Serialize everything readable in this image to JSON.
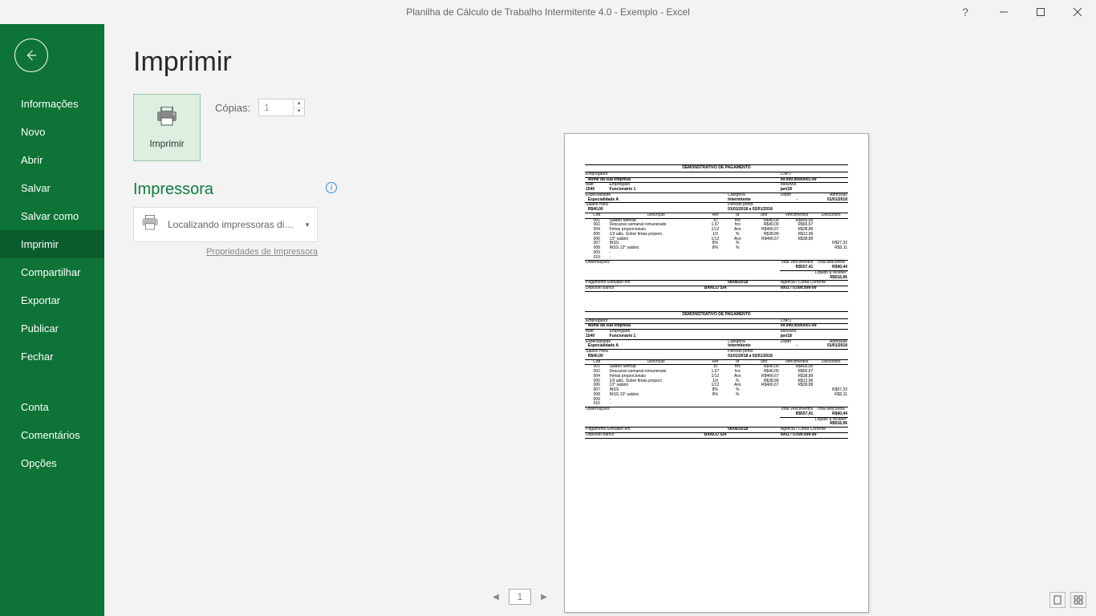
{
  "window": {
    "title": "Planilha de Cálculo de Trabalho Intermitente 4.0 - Exemplo  -  Excel"
  },
  "sidebar": {
    "items": [
      "Informações",
      "Novo",
      "Abrir",
      "Salvar",
      "Salvar como",
      "Imprimir",
      "Compartilhar",
      "Exportar",
      "Publicar",
      "Fechar",
      "Conta",
      "Comentários",
      "Opções"
    ],
    "active_index": 5
  },
  "print": {
    "heading": "Imprimir",
    "button_label": "Imprimir",
    "copies_label": "Cópias:",
    "copies_value": "1",
    "printer_heading": "Impressora",
    "printer_status": "Localizando impressoras dis...",
    "printer_props": "Propriedades de Impressora"
  },
  "pager": {
    "page": "1"
  },
  "slip": {
    "title": "DEMONSTRATIVO DE PAGAMENTO",
    "labels": {
      "empregador": "Empregador",
      "cnpj": "CNPJ",
      "matr": "Matr",
      "empregado": "Empregado",
      "mesano": "Mês/Ano",
      "especialidade": "Especialidade",
      "categoria": "Categoria",
      "depto": "Depto",
      "admissao": "Admissão",
      "salario_hora": "Salário Hora",
      "periodo_ponto": "Período ponto",
      "cod": "Cód",
      "descricao": "Descrição",
      "ref": "Ref",
      "id": "Id",
      "unit": "unit",
      "vencimentos": "Vencimentos",
      "descontos": "Descontos",
      "observacoes": "Observações:",
      "total_venc": "Total Vencimentos",
      "total_desc": "Total descontos",
      "liquido": "Líquido a receber:",
      "pag_efetuado": "Pagamento Efetuado em:",
      "agencia": "Agência / Conta Corrente",
      "deposito": "Depósito Banco"
    },
    "values": {
      "empresa": "Nome da sua empresa",
      "cnpj": "99.999.999/0001-99",
      "matr": "1540",
      "empregado": "Funcionário 1",
      "mesano": "jan/18",
      "especialidade": "Especialidade A",
      "categoria": "Intermitente",
      "depto": "-",
      "admissao": "01/01/2018",
      "salario_hora": "R$40,00",
      "periodo_ponto": "01/01/2018 a 02/01/2018",
      "obs": "",
      "total_venc": "R$557,41",
      "total_desc": "R$40,44",
      "liquido": "R$516,96",
      "pag_data": "06/06/2018",
      "banco": "BANCO S/A",
      "agencia": "0001 / 0.099.999-99"
    },
    "rows": [
      {
        "cod": "001",
        "desc": "Salário Mensal",
        "ref": "10",
        "id": "hrs",
        "unit": "R$40,00",
        "venc": "R$400,00",
        "desc2": ""
      },
      {
        "cod": "002",
        "desc": "Descanso semanal remunerado",
        "ref": "1,67",
        "id": "hrs",
        "unit": "R$40,00",
        "venc": "R$66,67",
        "desc2": ""
      },
      {
        "cod": "004",
        "desc": "Férias proporcionais",
        "ref": "1/12",
        "id": "Avo",
        "unit": "R$466,67",
        "venc": "R$38,89",
        "desc2": ""
      },
      {
        "cod": "005",
        "desc": "1/3 adic. Sobre férias proporc.",
        "ref": "1/3",
        "id": "%",
        "unit": "R$38,89",
        "venc": "R$12,96",
        "desc2": ""
      },
      {
        "cod": "006",
        "desc": "13° salário",
        "ref": "1/12",
        "id": "Avo",
        "unit": "R$466,67",
        "venc": "R$38,89",
        "desc2": ""
      },
      {
        "cod": "007",
        "desc": "INSS",
        "ref": "8%",
        "id": "%",
        "unit": "",
        "venc": "",
        "desc2": "R$37,33"
      },
      {
        "cod": "008",
        "desc": "INSS 13° salário",
        "ref": "8%",
        "id": "%",
        "unit": "",
        "venc": "",
        "desc2": "R$3,11"
      },
      {
        "cod": "009",
        "desc": "-",
        "ref": "",
        "id": "",
        "unit": "",
        "venc": "",
        "desc2": ""
      },
      {
        "cod": "010",
        "desc": "-",
        "ref": "",
        "id": "",
        "unit": "",
        "venc": "",
        "desc2": ""
      }
    ]
  }
}
